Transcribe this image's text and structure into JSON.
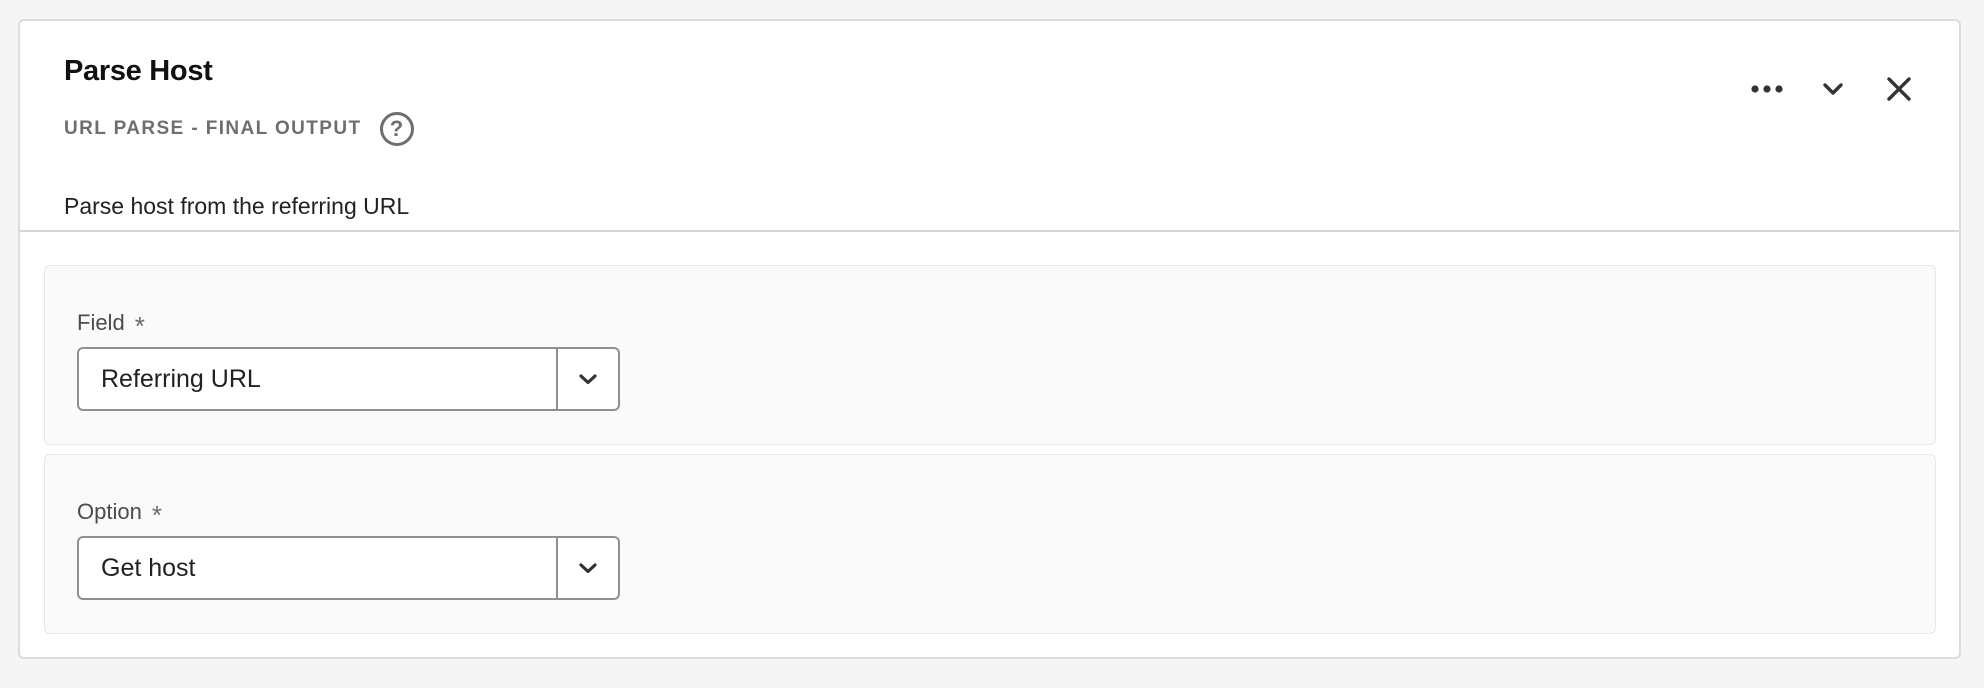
{
  "panel": {
    "title": "Parse Host",
    "subtitle": "URL PARSE - FINAL OUTPUT",
    "help_icon": "?",
    "description": "Parse host from the referring URL",
    "toolbar": {
      "more_icon": "more-horizontal-icon",
      "collapse_icon": "chevron-down-icon",
      "close_icon": "close-icon"
    }
  },
  "fields": [
    {
      "label": "Field",
      "required_mark": "*",
      "value": "Referring URL",
      "dropdown_icon": "chevron-down-icon"
    },
    {
      "label": "Option",
      "required_mark": "*",
      "value": "Get host",
      "dropdown_icon": "chevron-down-icon"
    }
  ]
}
